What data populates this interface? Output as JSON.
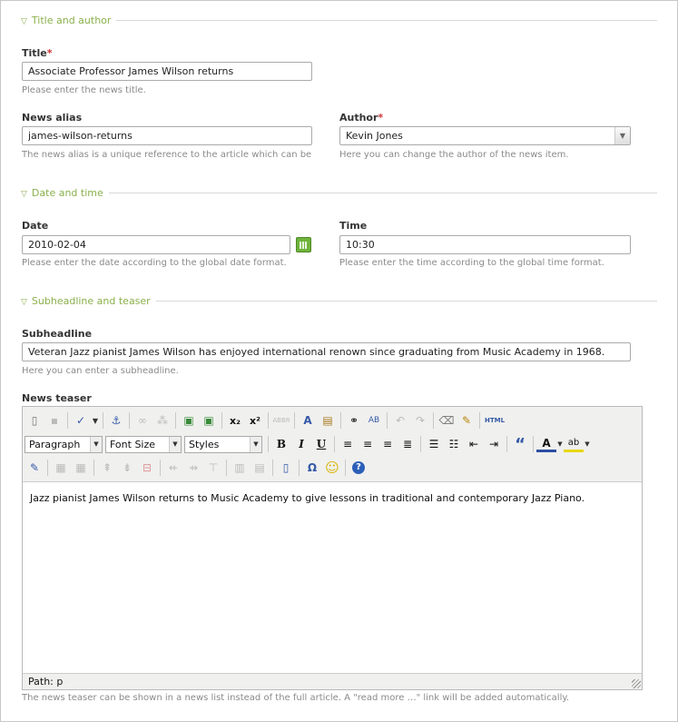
{
  "sections": {
    "title_author": "Title and author",
    "date_time": "Date and time",
    "subheadline_teaser": "Subheadline and teaser"
  },
  "title_field": {
    "label": "Title",
    "required": "*",
    "value": "Associate Professor James Wilson returns",
    "help": "Please enter the news title."
  },
  "alias_field": {
    "label": "News alias",
    "value": "james-wilson-returns",
    "help": "The news alias is a unique reference to the article which can be"
  },
  "author_field": {
    "label": "Author",
    "required": "*",
    "value": "Kevin Jones",
    "help": "Here you can change the author of the news item."
  },
  "date_field": {
    "label": "Date",
    "value": "2010-02-04",
    "help": "Please enter the date according to the global date format."
  },
  "time_field": {
    "label": "Time",
    "value": "10:30",
    "help": "Please enter the time according to the global time format."
  },
  "subheadline_field": {
    "label": "Subheadline",
    "value": "Veteran Jazz pianist James Wilson has enjoyed international renown since graduating from Music Academy in 1968.",
    "help": "Here you can enter a subheadline."
  },
  "teaser_field": {
    "label": "News teaser",
    "content": "Jazz pianist James Wilson returns to Music Academy to give lessons in traditional and contemporary Jazz Piano.",
    "status": "Path: p",
    "help": "The news teaser can be shown in a news list instead of the full article. A \"read more …\" link will be added automatically.",
    "format_select": "Paragraph",
    "fontsize_select": "Font Size",
    "styles_select": "Styles",
    "html_button": "HTML",
    "bold": "B",
    "italic": "I",
    "underline": "U",
    "subscript": "x₂",
    "superscript": "x²",
    "omega": "Ω",
    "help_btn": "?",
    "quote": "“",
    "font_color": "A",
    "highlight": "ab"
  },
  "colors": {
    "accent_green": "#8ab04b",
    "required_red": "#cc3333"
  }
}
